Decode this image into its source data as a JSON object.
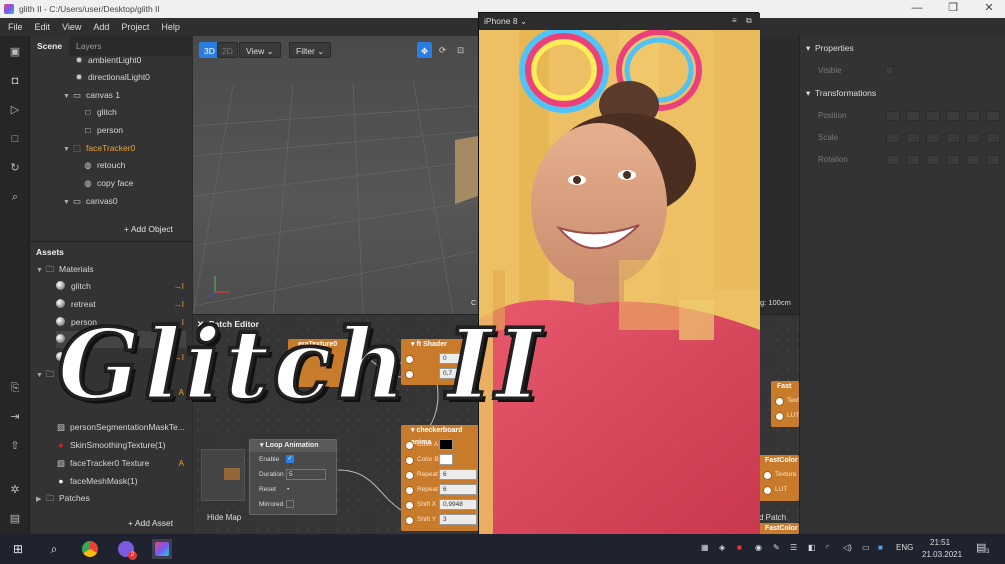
{
  "window": {
    "title": "glith II - C:/Users/user/Desktop/glith II",
    "controls": [
      "—",
      "❐",
      "✕"
    ]
  },
  "menu": [
    "File",
    "Edit",
    "View",
    "Add",
    "Project",
    "Help"
  ],
  "scene": {
    "tabs": [
      "Scene",
      "Layers"
    ],
    "items": [
      {
        "label": "ambientLight0",
        "depth": 2,
        "icon": "light-icon"
      },
      {
        "label": "directionalLight0",
        "depth": 2,
        "icon": "light-icon"
      },
      {
        "label": "canvas 1",
        "depth": 1,
        "icon": "canvas-icon",
        "expanded": true
      },
      {
        "label": "glitch",
        "depth": 2,
        "icon": "rectangle-icon"
      },
      {
        "label": "person",
        "depth": 2,
        "icon": "rectangle-icon"
      },
      {
        "label": "faceTracker0",
        "depth": 1,
        "icon": "face-tracker-icon",
        "expanded": true,
        "highlight": true
      },
      {
        "label": "retouch",
        "depth": 2,
        "icon": "mesh-icon"
      },
      {
        "label": "copy face",
        "depth": 2,
        "icon": "mesh-icon"
      },
      {
        "label": "canvas0",
        "depth": 1,
        "icon": "canvas-icon",
        "expanded": true
      }
    ],
    "add_label": "Add Object"
  },
  "assets": {
    "title": "Assets",
    "materials_folder": "Materials",
    "materials": [
      "glitch",
      "retreat",
      "person",
      "retr",
      "copy"
    ],
    "textures": [
      {
        "label": "personSegmentationMaskTe...",
        "icon": "texture-icon"
      },
      {
        "label": "SkinSmoothingTexture(1)",
        "icon": "red-dot-icon"
      },
      {
        "label": "faceTracker0 Texture",
        "icon": "texture-icon",
        "badge": "A"
      },
      {
        "label": "faceMeshMask(1)",
        "icon": "white-dot-icon"
      }
    ],
    "patches_folder": "Patches",
    "add_label": "Add Asset"
  },
  "viewport": {
    "mode_3d": "3D",
    "mode_2d": "2D",
    "view_label": "View",
    "filter_label": "Filter",
    "grid_info": "g: 100cm"
  },
  "patch_editor": {
    "title": "Patch Editor",
    "camera_node": "eraTexture0",
    "shader_node": "ft Shader",
    "shader_values": [
      "0",
      "0,7"
    ],
    "checker_node": "checkerboard anima",
    "checker_ports": [
      {
        "label": "Color A",
        "value": ""
      },
      {
        "label": "Color B",
        "value": ""
      },
      {
        "label": "Repeat X",
        "value": "6"
      },
      {
        "label": "Repeat Y",
        "value": "6"
      },
      {
        "label": "Shift X",
        "value": "0,9948"
      },
      {
        "label": "Shift Y",
        "value": "3"
      }
    ],
    "loop_node": "Loop Animation",
    "loop_rows": [
      "Enable",
      "Duration",
      "Reset",
      "Mirrored"
    ],
    "loop_duration": "5",
    "hide_map": "Hide Map",
    "fastcolor_1": "Fast",
    "fastcolor_2": "FastColor",
    "fastcolor_ports": [
      "Texture",
      "LUT"
    ],
    "patch_label": "d Patch",
    "fastcolor_3": "FastColor"
  },
  "properties": {
    "header": "Properties",
    "visible_label": "Visible",
    "transform_header": "Transformations",
    "rows": [
      "Position",
      "Scale",
      "Rotation"
    ]
  },
  "phone": {
    "device": "iPhone 8"
  },
  "overlay_title": "Glitch II",
  "taskbar": {
    "lang": "ENG",
    "time": "21:51",
    "date": "21.03.2021",
    "notif_count": "3",
    "badge": "2"
  }
}
